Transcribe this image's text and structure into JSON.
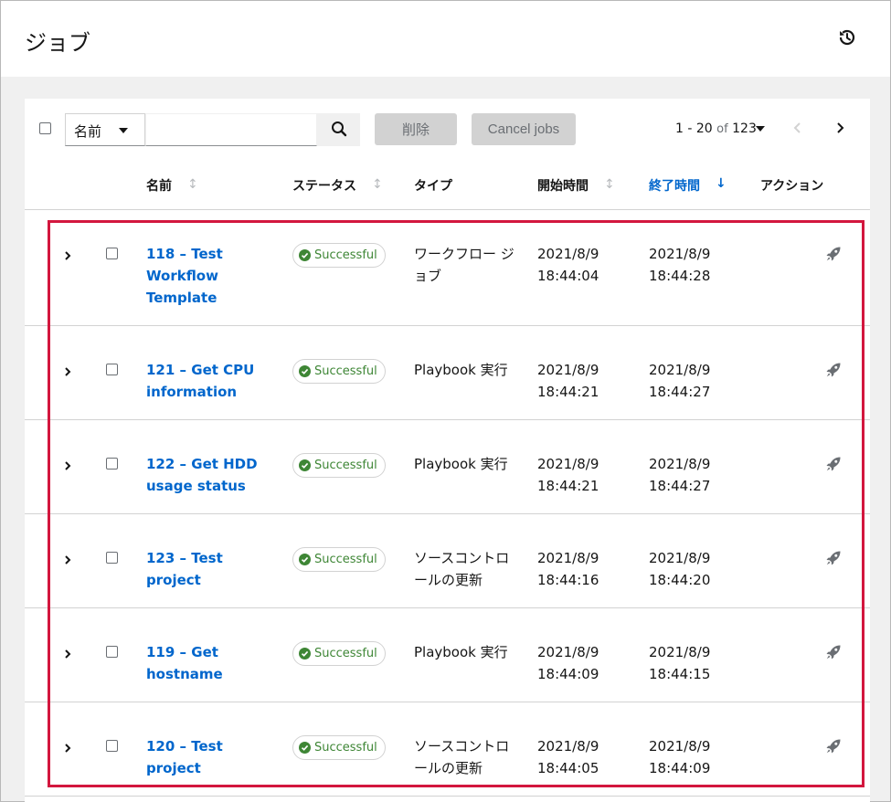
{
  "page": {
    "title": "ジョブ"
  },
  "toolbar": {
    "filter_field": "名前",
    "search_placeholder": "",
    "delete_label": "削除",
    "cancel_label": "Cancel jobs",
    "pagination": {
      "range": "1 - 20",
      "of": "of",
      "total": "123"
    }
  },
  "columns": {
    "name": "名前",
    "status": "ステータス",
    "type": "タイプ",
    "started": "開始時間",
    "finished": "終了時間",
    "actions": "アクション"
  },
  "colors": {
    "link": "#0066cc",
    "success": "#3e8635",
    "highlight": "#d3173e"
  },
  "jobs": [
    {
      "name": "118 – Test Workflow Template",
      "status": "Successful",
      "type": "ワークフロー ジョブ",
      "started_date": "2021/8/9",
      "started_time": "18:44:04",
      "finished_date": "2021/8/9",
      "finished_time": "18:44:28"
    },
    {
      "name": "121 – Get CPU information",
      "status": "Successful",
      "type": "Playbook 実行",
      "started_date": "2021/8/9",
      "started_time": "18:44:21",
      "finished_date": "2021/8/9",
      "finished_time": "18:44:27"
    },
    {
      "name": "122 – Get HDD usage status",
      "status": "Successful",
      "type": "Playbook 実行",
      "started_date": "2021/8/9",
      "started_time": "18:44:21",
      "finished_date": "2021/8/9",
      "finished_time": "18:44:27"
    },
    {
      "name": "123 – Test project",
      "status": "Successful",
      "type": "ソースコントロールの更新",
      "started_date": "2021/8/9",
      "started_time": "18:44:16",
      "finished_date": "2021/8/9",
      "finished_time": "18:44:20"
    },
    {
      "name": "119 – Get hostname",
      "status": "Successful",
      "type": "Playbook 実行",
      "started_date": "2021/8/9",
      "started_time": "18:44:09",
      "finished_date": "2021/8/9",
      "finished_time": "18:44:15"
    },
    {
      "name": "120 – Test project",
      "status": "Successful",
      "type": "ソースコントロールの更新",
      "started_date": "2021/8/9",
      "started_time": "18:44:05",
      "finished_date": "2021/8/9",
      "finished_time": "18:44:09"
    }
  ]
}
